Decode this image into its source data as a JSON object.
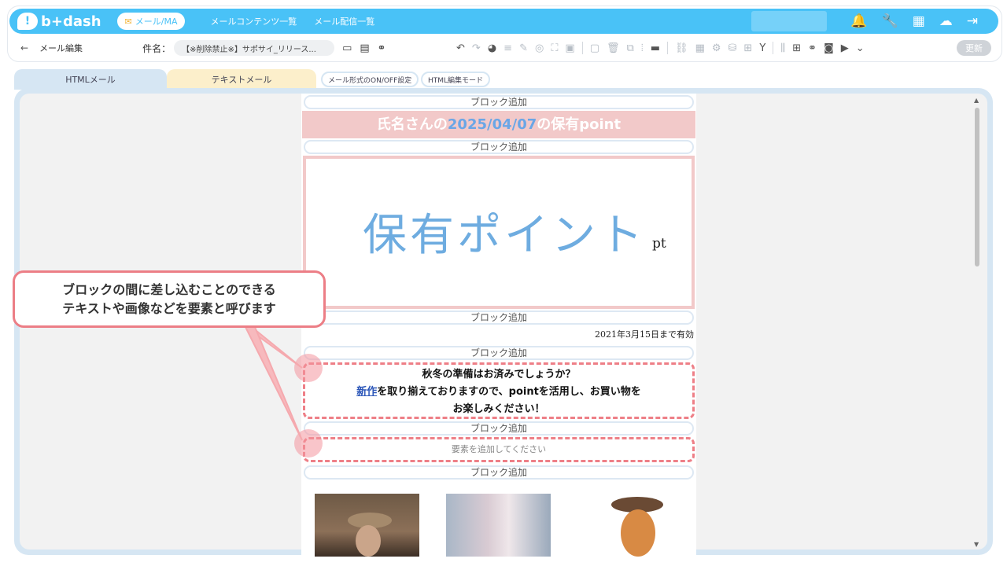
{
  "header": {
    "logo_text": "b+dash",
    "active_nav": "メール/MA",
    "nav_links": [
      "メールコンテンツ一覧",
      "メール配信一覧"
    ]
  },
  "subbar": {
    "back_label": "←",
    "page_title": "メール編集",
    "subject_label": "件名：",
    "subject_value": "【※削除禁止※】サポサイ_リリース...",
    "update_label": "更新"
  },
  "tabs": {
    "html": "HTMLメール",
    "text": "テキストメール",
    "format_toggle": "メール形式のON/OFF設定",
    "html_mode": "HTML編集モード"
  },
  "canvas": {
    "add_block_label": "ブロック追加",
    "header_prefix": "氏名さんの",
    "header_date": "2025/04/07",
    "header_suffix": "の保有point",
    "hero_title": "保有ポイント",
    "hero_unit": "pt",
    "expiry": "2021年3月15日まで有効",
    "message_line1": "秋冬の準備はお済みでしょうか？",
    "message_link": "新作",
    "message_line2_rest": "を取り揃えておりますので、pointを活用し、お買い物を",
    "message_line3": "お楽しみください！",
    "add_element_label": "要素を追加してください"
  },
  "callout": {
    "line1": "ブロックの間に差し込むことのできる",
    "line2": "テキストや画像などを要素と呼びます"
  },
  "colors": {
    "nav_blue": "#49c2f7",
    "header_pink": "#f2c9c9",
    "date_blue": "#6aa6e6",
    "dashed_red": "#ee7f87",
    "editor_blue": "#d6e6f3"
  },
  "icons": [
    "bell-icon",
    "wrench-icon",
    "grid-icon",
    "cloud-user-icon",
    "logout-icon"
  ]
}
